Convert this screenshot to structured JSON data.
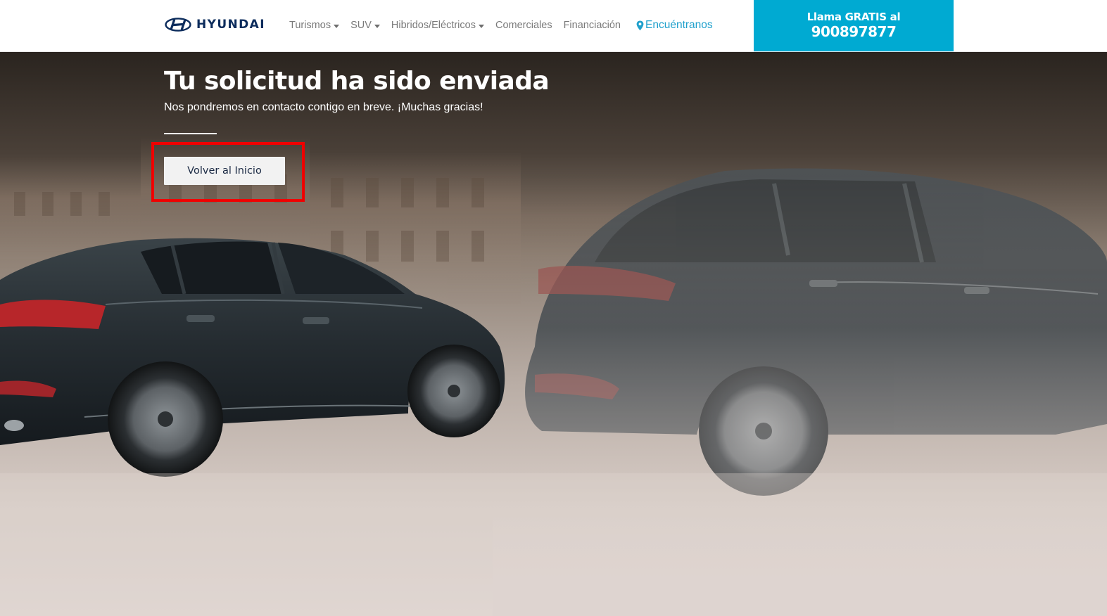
{
  "header": {
    "logo_text": "HYUNDAI",
    "nav": [
      {
        "label": "Turismos",
        "has_dropdown": true
      },
      {
        "label": "SUV",
        "has_dropdown": true
      },
      {
        "label": "Hibridos/Eléctricos",
        "has_dropdown": true
      },
      {
        "label": "Comerciales",
        "has_dropdown": false
      },
      {
        "label": "Financiación",
        "has_dropdown": false
      }
    ],
    "find_label": "Encuéntranos",
    "call": {
      "line1": "Llama GRATIS al",
      "phone": "900897877"
    }
  },
  "hero": {
    "title": "Tu solicitud ha sido enviada",
    "subtitle": "Nos pondremos en contacto contigo en breve. ¡Muchas gracias!",
    "button_label": "Volver al Inicio"
  },
  "colors": {
    "brand_navy": "#0c2c5c",
    "accent_blue": "#00aad2",
    "link_blue": "#1fa0cc",
    "highlight_red": "#f00000"
  },
  "icons": [
    "hyundai-logo-icon",
    "location-pin-icon",
    "chevron-down-icon"
  ]
}
